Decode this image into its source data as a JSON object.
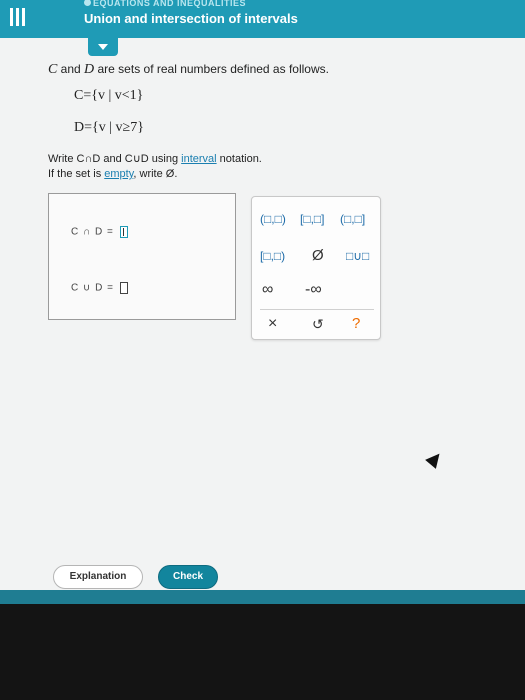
{
  "header": {
    "topic": "EQUATIONS AND INEQUALITIES",
    "title": "Union and intersection of intervals"
  },
  "problem": {
    "intro_part1": "C",
    "intro_part2": " and ",
    "intro_part3": "D",
    "intro_part4": " are sets of real numbers defined as follows.",
    "set_c": "C={v | v<1}",
    "set_d": "D={v | v≥7}",
    "instruction_prefix": "Write C∩D and C∪D using ",
    "instruction_link": "interval",
    "instruction_suffix": " notation.",
    "empty_prefix": "If the set is ",
    "empty_link": "empty",
    "empty_suffix": ", write Ø."
  },
  "answers": {
    "intersection_label": "C ∩ D =",
    "union_label": "C ∪ D ="
  },
  "keypad": {
    "open_open": "(□,□)",
    "closed_closed": "[□,□]",
    "open_closed": "(□,□]",
    "closed_open": "[□,□)",
    "empty_set": "Ø",
    "union": "□∪□",
    "infinity": "∞",
    "neg_infinity": "-∞",
    "clear": "×",
    "undo": "↺",
    "help": "?"
  },
  "footer": {
    "explanation_label": "Explanation",
    "check_label": "Check"
  }
}
